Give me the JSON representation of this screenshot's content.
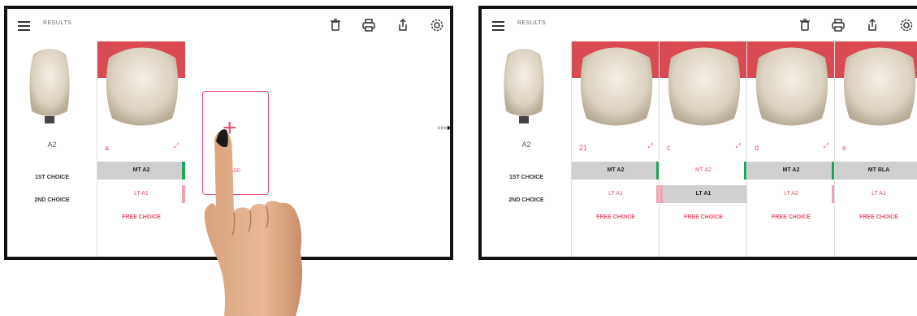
{
  "colors": {
    "accent": "#e84f6e",
    "green": "#1fa55a",
    "pink_bar": "#f2a3b3",
    "selected_bg": "#cfcfcf",
    "gum": "#d94a52"
  },
  "left": {
    "header": {
      "title": "RESULTS"
    },
    "reference": {
      "name": "A2",
      "first_choice_label": "1ST CHOICE",
      "second_choice_label": "2ND CHOICE"
    },
    "column": {
      "letter": "a",
      "first": "MT A2",
      "second": "LT A1",
      "free": "FREE CHOICE"
    },
    "add_card": {
      "plus": "+",
      "label": "ADD"
    }
  },
  "right": {
    "header": {
      "title": "RESULTS"
    },
    "reference": {
      "name": "A2",
      "first_choice_label": "1ST CHOICE",
      "second_choice_label": "2ND CHOICE"
    },
    "columns": [
      {
        "letter": "21",
        "first": "MT A2",
        "second": "LT A1",
        "free": "FREE CHOICE"
      },
      {
        "letter": "c",
        "first": "MT A2",
        "second": "LT A1",
        "free": "FREE CHOICE"
      },
      {
        "letter": "d",
        "first": "MT A2",
        "second": "LT A2",
        "free": "FREE CHOICE"
      },
      {
        "letter": "e",
        "first": "MT BLA",
        "second": "LT A1",
        "free": "FREE CHOICE"
      }
    ]
  },
  "transition_arrows": "▸▸▸"
}
